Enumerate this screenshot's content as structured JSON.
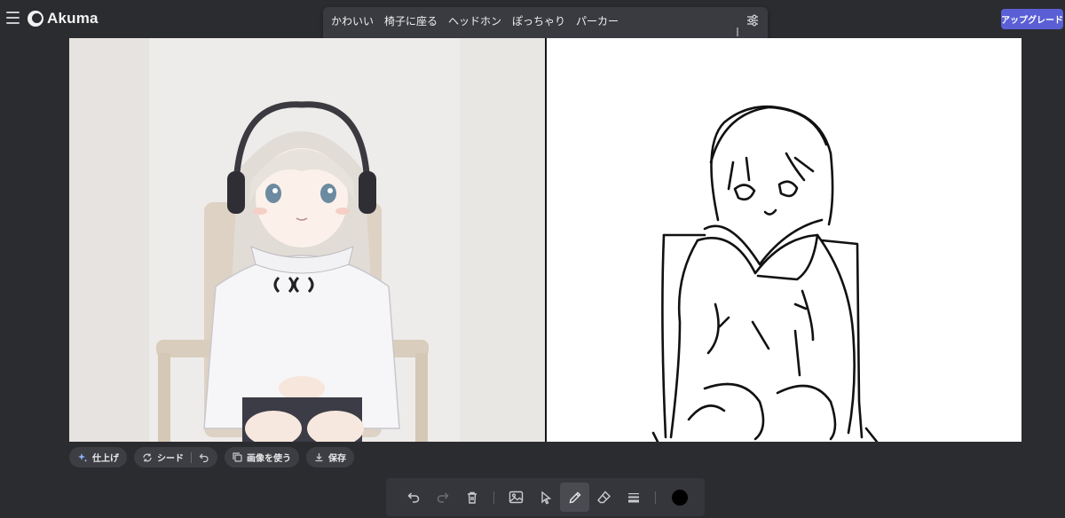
{
  "app": {
    "name": "Akuma"
  },
  "header": {
    "menu_icon": "hamburger-icon",
    "upgrade_label": "アップグレード",
    "upgrade_color": "#5b5fd6"
  },
  "prompt": {
    "text": "かわいい　椅子に座る　ヘッドホン　ぽっちゃり　パーカー",
    "settings_icon": "sliders-icon"
  },
  "canvas": {
    "generated_image": "anime girl with headphones sitting on chair",
    "sketch_image": "line drawing of girl sitting on chair",
    "background": "#ffffff"
  },
  "actions": {
    "finish_label": "仕上げ",
    "seed_label": "シード",
    "use_image_label": "画像を使う",
    "save_label": "保存"
  },
  "tools": {
    "items": [
      "undo-icon",
      "redo-icon",
      "trash-icon",
      "image-icon",
      "select-icon",
      "pencil-icon",
      "eraser-icon",
      "stroke-width-icon"
    ],
    "active": "pencil-icon",
    "brush_color": "#000000"
  }
}
